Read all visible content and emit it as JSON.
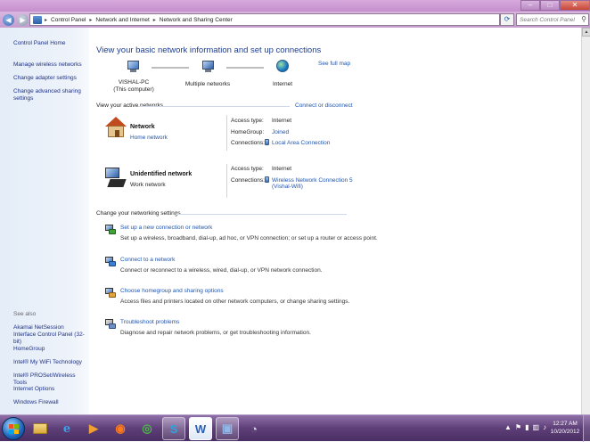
{
  "window": {
    "controls": [
      "–",
      "□",
      "✕"
    ]
  },
  "address": {
    "back": "◀",
    "forward": "▶",
    "dropdown": "▾",
    "crumbs": [
      "Control Panel",
      "Network and Internet",
      "Network and Sharing Center"
    ],
    "separator": "▸",
    "refresh": "⟳",
    "search_placeholder": "Search Control Panel",
    "search_glyph": "⚲"
  },
  "sidebar": {
    "home": "Control Panel Home",
    "links": [
      "Manage wireless networks",
      "Change adapter settings",
      "Change advanced sharing settings"
    ],
    "see_also_heading": "See also",
    "see_also": [
      "Akamai NetSession Interface Control Panel (32-bit)",
      "HomeGroup",
      "Intel® My WiFi Technology",
      "Intel® PROSet/Wireless Tools",
      "Internet Options",
      "Windows Firewall"
    ]
  },
  "main": {
    "title": "View your basic network information and set up connections",
    "see_full_map": "See full map",
    "map": {
      "node1": "VISHAL-PC",
      "node1_sub": "(This computer)",
      "node2": "Multiple networks",
      "node3": "Internet"
    },
    "active_heading": "View your active networks",
    "connect_link": "Connect or disconnect",
    "networks": [
      {
        "name": "Network",
        "type": "Home network",
        "access_label": "Access type:",
        "access_value": "Internet",
        "homegroup_label": "HomeGroup:",
        "homegroup_value": "Joined",
        "connections_label": "Connections:",
        "connection": "Local Area Connection"
      },
      {
        "name": "Unidentified network",
        "type": "Work network",
        "access_label": "Access type:",
        "access_value": "Internet",
        "connections_label": "Connections:",
        "connection_line1": "Wireless Network Connection 5",
        "connection_line2": "(Vishal-Wifi)"
      }
    ],
    "settings_heading": "Change your networking settings",
    "tasks": [
      {
        "title": "Set up a new connection or network",
        "desc": "Set up a wireless, broadband, dial-up, ad hoc, or VPN connection; or set up a router or access point."
      },
      {
        "title": "Connect to a network",
        "desc": "Connect or reconnect to a wireless, wired, dial-up, or VPN network connection."
      },
      {
        "title": "Choose homegroup and sharing options",
        "desc": "Access files and printers located on other network computers, or change sharing settings."
      },
      {
        "title": "Troubleshoot problems",
        "desc": "Diagnose and repair network problems, or get troubleshooting information."
      }
    ]
  },
  "taskbar": {
    "apps": [
      {
        "glyph": "",
        "color": "#d9b24a"
      },
      {
        "glyph": "e",
        "color": "#3aa0e8"
      },
      {
        "glyph": "▶",
        "color": "#f0a030"
      },
      {
        "glyph": "◉",
        "color": "#ff7a1a"
      },
      {
        "glyph": "◎",
        "color": "#4cb848"
      },
      {
        "glyph": "S",
        "color": "#2aa5e0"
      },
      {
        "glyph": "W",
        "color": "#2b5fb3"
      },
      {
        "glyph": "▣",
        "color": "#8fb8e8"
      },
      {
        "glyph": "◔",
        "color": "#cfd6dd"
      }
    ],
    "tray_icons": [
      "▲",
      "⚑",
      "▮",
      "▥",
      "♪"
    ],
    "time": "12:27 AM",
    "date": "10/20/2012"
  },
  "colors": {
    "link": "#1e55b0",
    "title": "#1e3d8f",
    "taskbar": "#5e3f78",
    "chrome": "#c79dd0"
  }
}
